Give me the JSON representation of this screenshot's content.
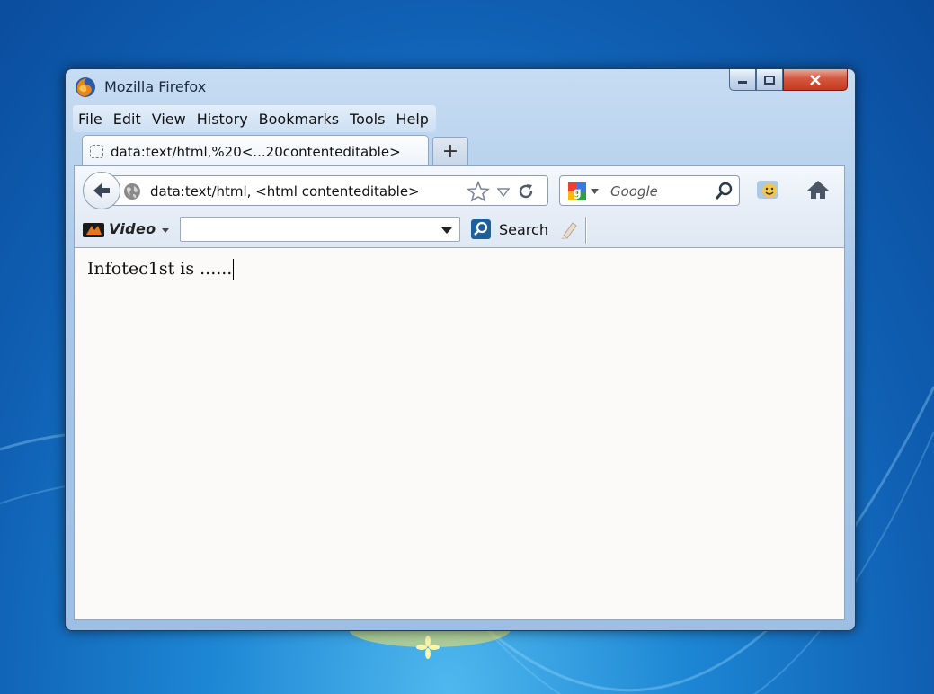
{
  "window": {
    "title": "Mozilla Firefox"
  },
  "menu": [
    "File",
    "Edit",
    "View",
    "History",
    "Bookmarks",
    "Tools",
    "Help"
  ],
  "tab": {
    "title": "data:text/html,%20<...20contenteditable>"
  },
  "newtab": {
    "label": "+"
  },
  "address": {
    "url": "data:text/html, <html contenteditable>"
  },
  "search": {
    "engine": "Google",
    "placeholder": "Google"
  },
  "custom_toolbar": {
    "video_label": "Video",
    "search_label": "Search",
    "combo_value": ""
  },
  "page": {
    "text": "Infotec1st is ......"
  },
  "colors": {
    "desktop": "#1d86d4",
    "close_button": "#c23a1f",
    "content_bg": "#fcfaf8"
  }
}
